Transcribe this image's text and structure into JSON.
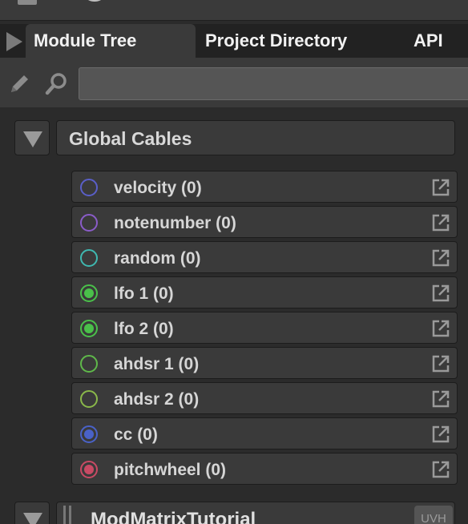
{
  "tabs": [
    {
      "label": "Module Tree",
      "active": true
    },
    {
      "label": "Project Directory",
      "active": false
    },
    {
      "label": "API",
      "active": false
    }
  ],
  "search": {
    "value": "",
    "placeholder": ""
  },
  "group": {
    "title": "Global Cables",
    "icon": "triangle-down-icon"
  },
  "cables": [
    {
      "label": "velocity (0)",
      "ring": "#5a5fc8",
      "fill": ""
    },
    {
      "label": "notenumber (0)",
      "ring": "#8a5cc8",
      "fill": ""
    },
    {
      "label": "random (0)",
      "ring": "#3fb8b0",
      "fill": ""
    },
    {
      "label": "lfo 1 (0)",
      "ring": "#4ac04a",
      "fill": "#4ac04a"
    },
    {
      "label": "lfo 2 (0)",
      "ring": "#4ac04a",
      "fill": "#4ac04a"
    },
    {
      "label": "ahdsr 1 (0)",
      "ring": "#5fb84a",
      "fill": ""
    },
    {
      "label": "ahdsr 2 (0)",
      "ring": "#8ab84a",
      "fill": ""
    },
    {
      "label": "cc (0)",
      "ring": "#4a62c8",
      "fill": "#4a62c8"
    },
    {
      "label": "pitchwheel (0)",
      "ring": "#c84a64",
      "fill": "#c84a64"
    }
  ],
  "module": {
    "name": "ModMatrixTutorial",
    "badge": "UVH"
  }
}
